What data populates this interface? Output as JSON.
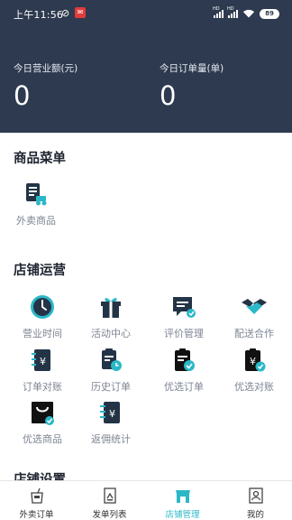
{
  "status_bar": {
    "time": "上午11:56",
    "battery": "89",
    "icons": [
      "mute-icon",
      "app-notification-icon",
      "signal-icon",
      "signal-icon",
      "wifi-icon",
      "battery-icon"
    ]
  },
  "header": {
    "stats": [
      {
        "label": "今日营业额(元)",
        "value": "0"
      },
      {
        "label": "今日订单量(单)",
        "value": "0"
      }
    ],
    "background": "#2e3a4f"
  },
  "sections": {
    "menu": {
      "title": "商品菜单",
      "items": [
        {
          "label": "外卖商品",
          "icon": "takeout-goods-icon"
        }
      ]
    },
    "operations": {
      "title": "店铺运营",
      "items": [
        {
          "label": "营业时间",
          "icon": "clock-icon"
        },
        {
          "label": "活动中心",
          "icon": "gift-icon"
        },
        {
          "label": "评价管理",
          "icon": "review-icon"
        },
        {
          "label": "配送合作",
          "icon": "handshake-icon"
        },
        {
          "label": "订单对账",
          "icon": "order-reconcile-icon"
        },
        {
          "label": "历史订单",
          "icon": "history-order-icon"
        },
        {
          "label": "优选订单",
          "icon": "preferred-order-icon"
        },
        {
          "label": "优选对账",
          "icon": "preferred-reconcile-icon"
        },
        {
          "label": "优选商品",
          "icon": "preferred-goods-icon"
        },
        {
          "label": "返佣统计",
          "icon": "rebate-stats-icon"
        }
      ]
    },
    "settings_partial": {
      "title": "店铺设置"
    }
  },
  "bottom_nav": {
    "items": [
      {
        "label": "外卖订单",
        "icon": "takeout-order-icon",
        "active": false
      },
      {
        "label": "发单列表",
        "icon": "dispatch-list-icon",
        "active": false
      },
      {
        "label": "店铺管理",
        "icon": "store-icon",
        "active": true
      },
      {
        "label": "我的",
        "icon": "profile-icon",
        "active": false
      }
    ],
    "active_color": "#2bb8c8"
  }
}
